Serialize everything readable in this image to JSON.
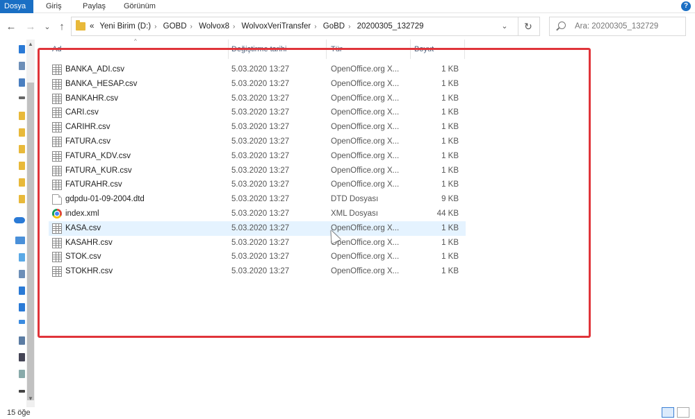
{
  "ribbon": {
    "tabs": [
      "Dosya",
      "Giriş",
      "Paylaş",
      "Görünüm"
    ]
  },
  "nav": {
    "back_icon": "←",
    "forward_icon": "→",
    "recent_icon": "⌄",
    "up_icon": "↑"
  },
  "address": {
    "overflow": "«",
    "crumbs": [
      "Yeni Birim (D:)",
      "GOBD",
      "Wolvox8",
      "WolvoxVeriTransfer",
      "GoBD",
      "20200305_132729"
    ],
    "drop_icon": "⌄",
    "refresh_icon": "↻"
  },
  "search": {
    "placeholder": "Ara: 20200305_132729"
  },
  "columns": {
    "name": "Ad",
    "date": "Değiştirme tarihi",
    "type": "Tür",
    "size": "Boyut"
  },
  "files": [
    {
      "name": "BANKA_ADI.csv",
      "date": "5.03.2020 13:27",
      "type": "OpenOffice.org X...",
      "size": "1 KB",
      "icon": "csv-icon"
    },
    {
      "name": "BANKA_HESAP.csv",
      "date": "5.03.2020 13:27",
      "type": "OpenOffice.org X...",
      "size": "1 KB",
      "icon": "csv-icon"
    },
    {
      "name": "BANKAHR.csv",
      "date": "5.03.2020 13:27",
      "type": "OpenOffice.org X...",
      "size": "1 KB",
      "icon": "csv-icon"
    },
    {
      "name": "CARI.csv",
      "date": "5.03.2020 13:27",
      "type": "OpenOffice.org X...",
      "size": "1 KB",
      "icon": "csv-icon"
    },
    {
      "name": "CARIHR.csv",
      "date": "5.03.2020 13:27",
      "type": "OpenOffice.org X...",
      "size": "1 KB",
      "icon": "csv-icon"
    },
    {
      "name": "FATURA.csv",
      "date": "5.03.2020 13:27",
      "type": "OpenOffice.org X...",
      "size": "1 KB",
      "icon": "csv-icon"
    },
    {
      "name": "FATURA_KDV.csv",
      "date": "5.03.2020 13:27",
      "type": "OpenOffice.org X...",
      "size": "1 KB",
      "icon": "csv-icon"
    },
    {
      "name": "FATURA_KUR.csv",
      "date": "5.03.2020 13:27",
      "type": "OpenOffice.org X...",
      "size": "1 KB",
      "icon": "csv-icon"
    },
    {
      "name": "FATURAHR.csv",
      "date": "5.03.2020 13:27",
      "type": "OpenOffice.org X...",
      "size": "1 KB",
      "icon": "csv-icon"
    },
    {
      "name": "gdpdu-01-09-2004.dtd",
      "date": "5.03.2020 13:27",
      "type": "DTD Dosyası",
      "size": "9 KB",
      "icon": "dtd-file-icon"
    },
    {
      "name": "index.xml",
      "date": "5.03.2020 13:27",
      "type": "XML Dosyası",
      "size": "44 KB",
      "icon": "chrome-icon"
    },
    {
      "name": "KASA.csv",
      "date": "5.03.2020 13:27",
      "type": "OpenOffice.org X...",
      "size": "1 KB",
      "icon": "csv-icon",
      "hover": true
    },
    {
      "name": "KASAHR.csv",
      "date": "5.03.2020 13:27",
      "type": "OpenOffice.org X...",
      "size": "1 KB",
      "icon": "csv-icon"
    },
    {
      "name": "STOK.csv",
      "date": "5.03.2020 13:27",
      "type": "OpenOffice.org X...",
      "size": "1 KB",
      "icon": "csv-icon"
    },
    {
      "name": "STOKHR.csv",
      "date": "5.03.2020 13:27",
      "type": "OpenOffice.org X...",
      "size": "1 KB",
      "icon": "csv-icon"
    }
  ],
  "status": {
    "count": "15 öğe"
  },
  "colors": {
    "accent": "#1a6fc4",
    "annotation": "#e0343a",
    "hover_row": "#e5f3ff"
  }
}
